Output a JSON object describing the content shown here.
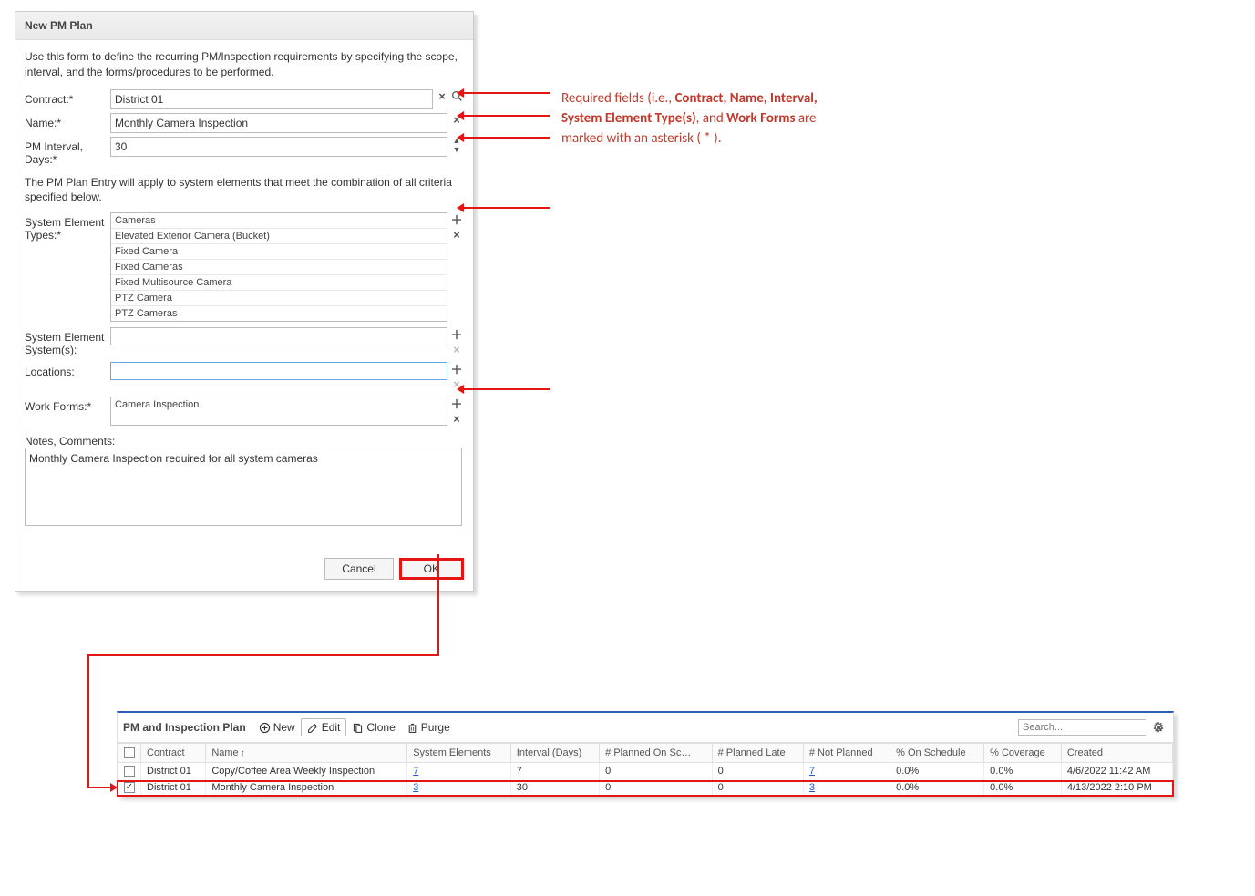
{
  "dialog": {
    "title": "New PM Plan",
    "intro": "Use this form to define the recurring PM/Inspection requirements by specifying the scope, interval, and the forms/procedures to be performed.",
    "labels": {
      "contract": "Contract:*",
      "name": "Name:*",
      "interval": "PM Interval, Days:*",
      "types": "System Element Types:*",
      "systems": "System Element System(s):",
      "locations": "Locations:",
      "workforms": "Work Forms:*",
      "notes": "Notes, Comments:"
    },
    "values": {
      "contract": "District 01",
      "name": "Monthly Camera Inspection",
      "interval": "30",
      "notes": "Monthly Camera Inspection required for all system cameras"
    },
    "systemElementTypes": [
      "Cameras",
      "Elevated Exterior Camera (Bucket)",
      "Fixed Camera",
      "Fixed Cameras",
      "Fixed Multisource Camera",
      "PTZ Camera",
      "PTZ Cameras"
    ],
    "workForms": [
      "Camera Inspection"
    ],
    "criteriaText": "The PM Plan Entry will apply to system elements that meet the combination of all criteria specified below.",
    "buttons": {
      "cancel": "Cancel",
      "ok": "OK"
    }
  },
  "annotation": {
    "prefix": "Required fields (i.e., ",
    "b1": "Contract, Name, Interval, System Element Type(s)",
    "mid": ", and ",
    "b2": "Work Forms",
    "suffix": " are marked with an asterisk ( * )."
  },
  "panel": {
    "title": "PM and Inspection Plan",
    "toolbar": {
      "new": "New",
      "edit": "Edit",
      "clone": "Clone",
      "purge": "Purge"
    },
    "searchPlaceholder": "Search...",
    "columns": [
      "Contract",
      "Name",
      "System Elements",
      "Interval (Days)",
      "# Planned On Sc…",
      "# Planned Late",
      "# Not Planned",
      "% On Schedule",
      "% Coverage",
      "Created"
    ],
    "rows": [
      {
        "checked": false,
        "contract": "District 01",
        "name": "Copy/Coffee Area Weekly Inspection",
        "sysElems": "7",
        "interval": "7",
        "onSched": "0",
        "late": "0",
        "notPlanned": "7",
        "pctSched": "0.0%",
        "pctCov": "0.0%",
        "created": "4/6/2022 11:42 AM",
        "selected": false
      },
      {
        "checked": true,
        "contract": "District 01",
        "name": "Monthly Camera Inspection",
        "sysElems": "3",
        "interval": "30",
        "onSched": "0",
        "late": "0",
        "notPlanned": "3",
        "pctSched": "0.0%",
        "pctCov": "0.0%",
        "created": "4/13/2022 2:10 PM",
        "selected": true
      }
    ]
  }
}
